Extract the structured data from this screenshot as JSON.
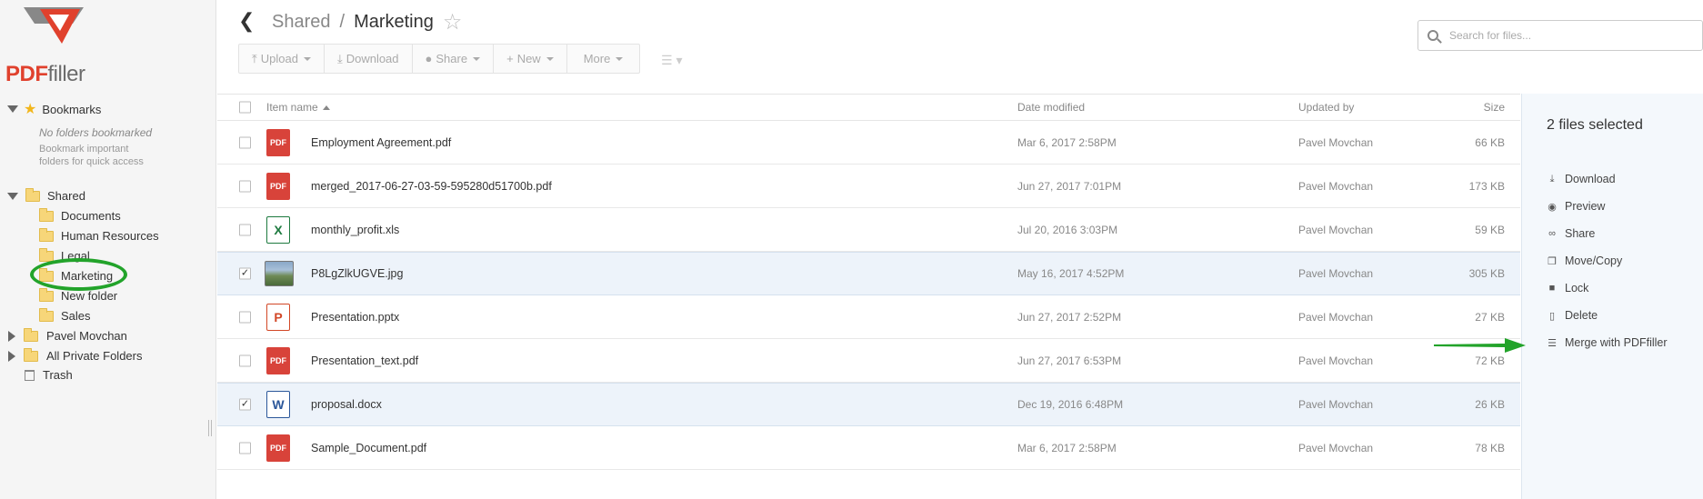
{
  "logo": {
    "text_red": "PDF",
    "text_grey": "filler"
  },
  "sidebar": {
    "bookmarks": {
      "label": "Bookmarks",
      "empty_title": "No folders bookmarked",
      "empty_hint": "Bookmark important folders for quick access"
    },
    "shared": {
      "label": "Shared",
      "children": [
        "Documents",
        "Human Resources",
        "Legal",
        "Marketing",
        "New folder",
        "Sales"
      ]
    },
    "roots": [
      "Pavel Movchan",
      "All Private Folders"
    ],
    "trash": "Trash"
  },
  "header": {
    "breadcrumb_parent": "Shared",
    "breadcrumb_sep": "/",
    "breadcrumb_current": "Marketing"
  },
  "toolbar": {
    "upload": "Upload",
    "download": "Download",
    "share": "Share",
    "new": "New",
    "more": "More"
  },
  "search": {
    "placeholder": "Search for files..."
  },
  "table": {
    "headers": {
      "name": "Item name",
      "date": "Date modified",
      "user": "Updated by",
      "size": "Size"
    },
    "rows": [
      {
        "name": "Employment Agreement.pdf",
        "date": "Mar 6, 2017 2:58PM",
        "user": "Pavel Movchan",
        "size": "66 KB",
        "type": "pdf",
        "selected": false
      },
      {
        "name": "merged_2017-06-27-03-59-595280d51700b.pdf",
        "date": "Jun 27, 2017 7:01PM",
        "user": "Pavel Movchan",
        "size": "173 KB",
        "type": "pdf",
        "selected": false
      },
      {
        "name": "monthly_profit.xls",
        "date": "Jul 20, 2016 3:03PM",
        "user": "Pavel Movchan",
        "size": "59 KB",
        "type": "xls",
        "selected": false
      },
      {
        "name": "P8LgZlkUGVE.jpg",
        "date": "May 16, 2017 4:52PM",
        "user": "Pavel Movchan",
        "size": "305 KB",
        "type": "img",
        "selected": true
      },
      {
        "name": "Presentation.pptx",
        "date": "Jun 27, 2017 2:52PM",
        "user": "Pavel Movchan",
        "size": "27 KB",
        "type": "ppt",
        "selected": false
      },
      {
        "name": "Presentation_text.pdf",
        "date": "Jun 27, 2017 6:53PM",
        "user": "Pavel Movchan",
        "size": "72 KB",
        "type": "pdf",
        "selected": false
      },
      {
        "name": "proposal.docx",
        "date": "Dec 19, 2016 6:48PM",
        "user": "Pavel Movchan",
        "size": "26 KB",
        "type": "doc",
        "selected": true
      },
      {
        "name": "Sample_Document.pdf",
        "date": "Mar 6, 2017 2:58PM",
        "user": "Pavel Movchan",
        "size": "78 KB",
        "type": "pdf",
        "selected": false
      }
    ]
  },
  "file_icon_labels": {
    "pdf": "PDF",
    "xls": "X",
    "ppt": "P",
    "doc": "W"
  },
  "right_panel": {
    "title": "2 files selected",
    "actions": [
      "Download",
      "Preview",
      "Share",
      "Move/Copy",
      "Lock",
      "Delete",
      "Merge with PDFfiller"
    ]
  },
  "colors": {
    "brand_red": "#e0412d",
    "annotation_green": "#22a32a",
    "selected_row": "#edf3fa"
  }
}
